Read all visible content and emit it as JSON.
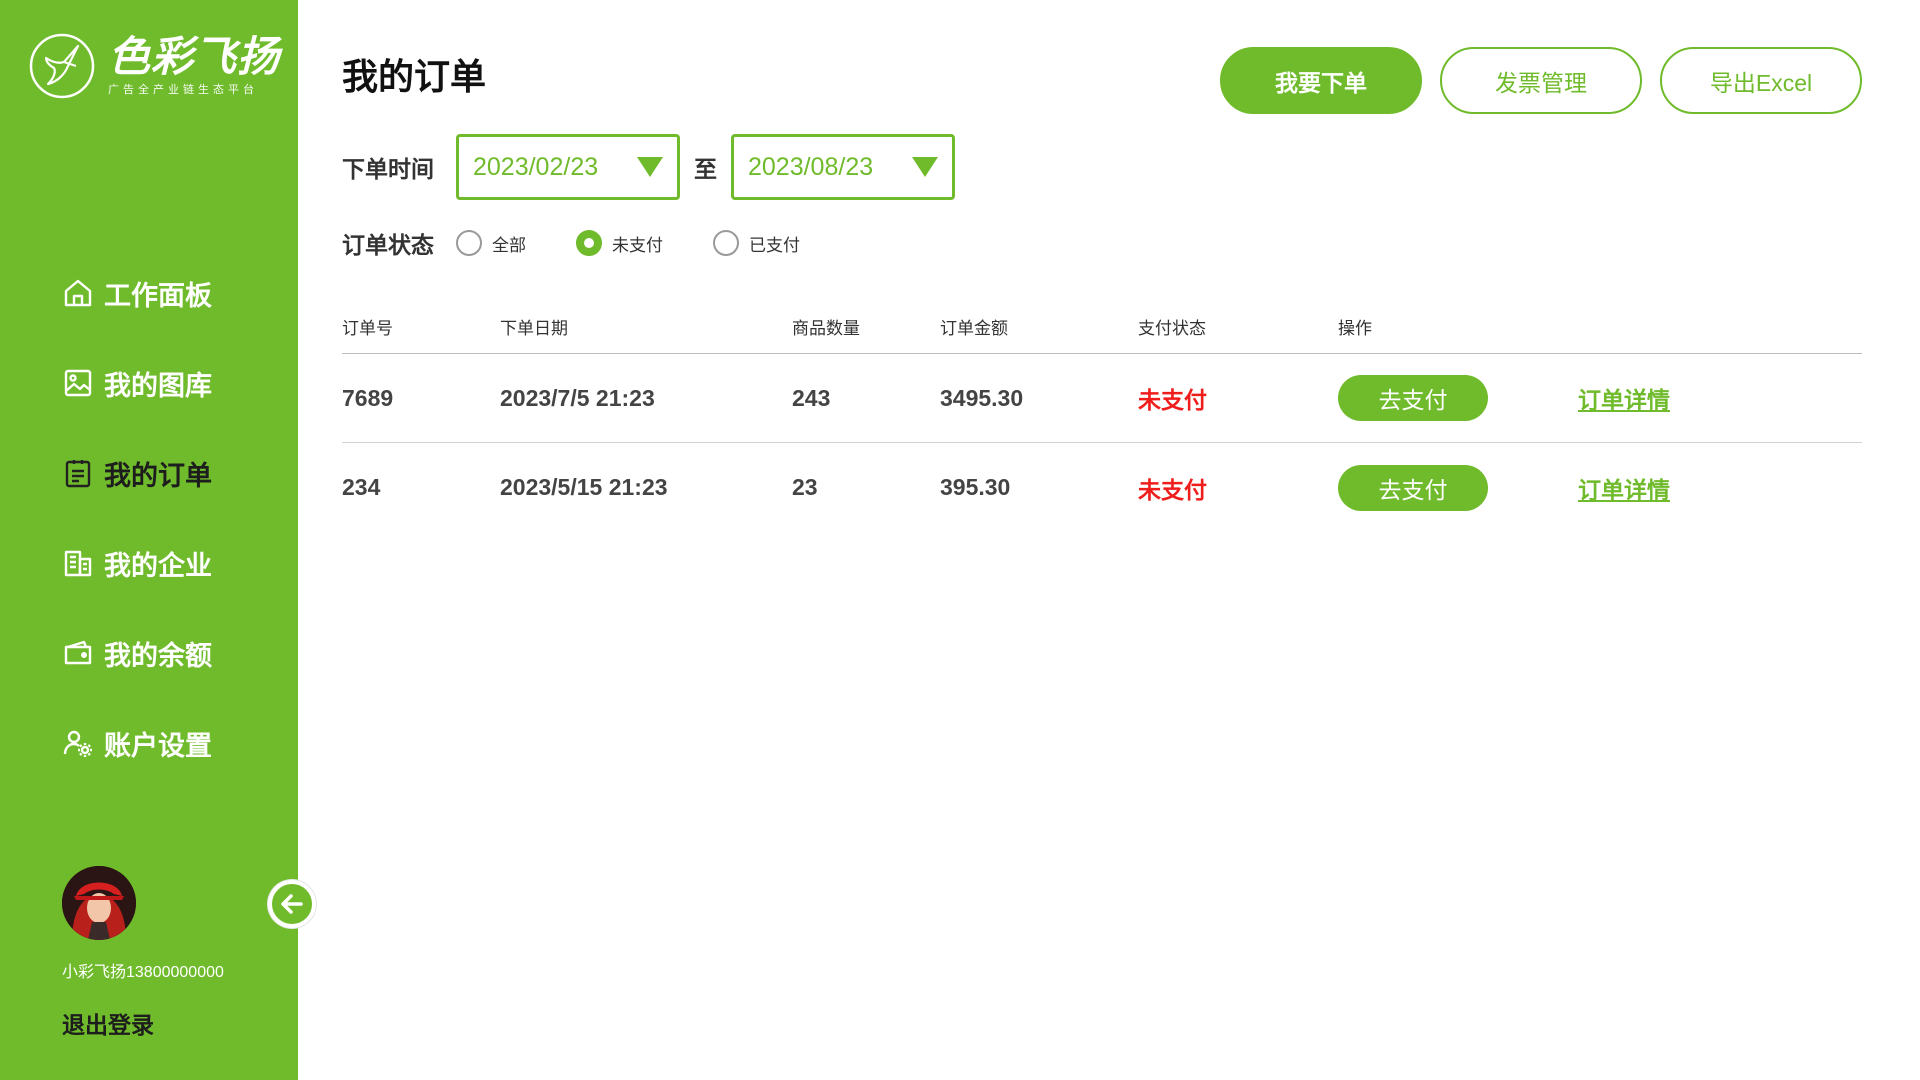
{
  "app": {
    "name": "色彩飞扬",
    "slogan": "广告全产业链生态平台"
  },
  "sidebar": {
    "items": [
      {
        "label": "工作面板",
        "icon": "home-icon"
      },
      {
        "label": "我的图库",
        "icon": "image-icon"
      },
      {
        "label": "我的订单",
        "icon": "clipboard-icon",
        "active": true
      },
      {
        "label": "我的企业",
        "icon": "building-icon"
      },
      {
        "label": "我的余额",
        "icon": "wallet-icon"
      },
      {
        "label": "账户设置",
        "icon": "user-settings-icon"
      }
    ],
    "user": {
      "name": "小彩飞扬13800000000"
    },
    "logout_label": "退出登录"
  },
  "header": {
    "title": "我的订单",
    "buttons": {
      "place_order": "我要下单",
      "invoice": "发票管理",
      "export": "导出Excel"
    }
  },
  "filters": {
    "date_label": "下单时间",
    "date_from": "2023/02/23",
    "to_label": "至",
    "date_to": "2023/08/23",
    "status_label": "订单状态",
    "status_options": [
      {
        "label": "全部",
        "checked": false
      },
      {
        "label": "未支付",
        "checked": true
      },
      {
        "label": "已支付",
        "checked": false
      }
    ]
  },
  "table": {
    "columns": [
      "订单号",
      "下单日期",
      "商品数量",
      "订单金额",
      "支付状态",
      "操作"
    ],
    "rows": [
      {
        "id": "7689",
        "date": "2023/7/5 21:23",
        "qty": "243",
        "amount": "3495.30",
        "status": "未支付",
        "pay_label": "去支付",
        "detail_label": "订单详情"
      },
      {
        "id": "234",
        "date": "2023/5/15 21:23",
        "qty": "23",
        "amount": "395.30",
        "status": "未支付",
        "pay_label": "去支付",
        "detail_label": "订单详情"
      }
    ]
  },
  "colors": {
    "brand": "#6fbb2b",
    "unpaid": "#f01d1d"
  }
}
